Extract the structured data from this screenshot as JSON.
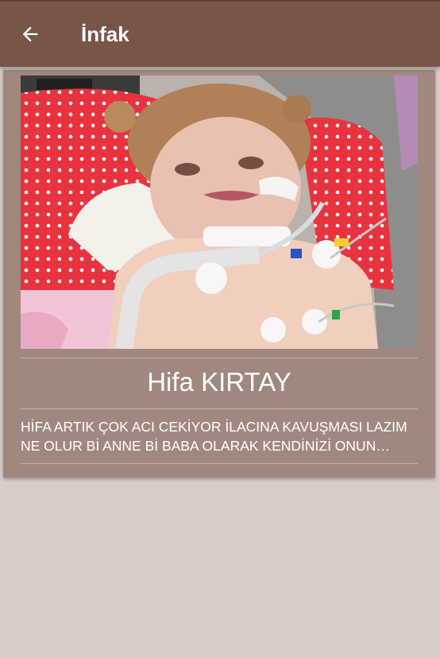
{
  "appbar": {
    "title": "İnfak",
    "back_icon": "arrow-left-icon"
  },
  "card": {
    "photo_icon": "child-photo",
    "name": "Hifa KIRTAY",
    "description": "HİFA ARTIK ÇOK ACI CEKİYOR İLACINA KAVUŞMASI LAZIM NE OLUR Bİ ANNE Bİ BABA OLARAK KENDİNİZİ ONUN YERİNE KOYUN"
  },
  "colors": {
    "appbar": "#795548",
    "card": "#a1887f",
    "background": "#d7ccc8"
  }
}
